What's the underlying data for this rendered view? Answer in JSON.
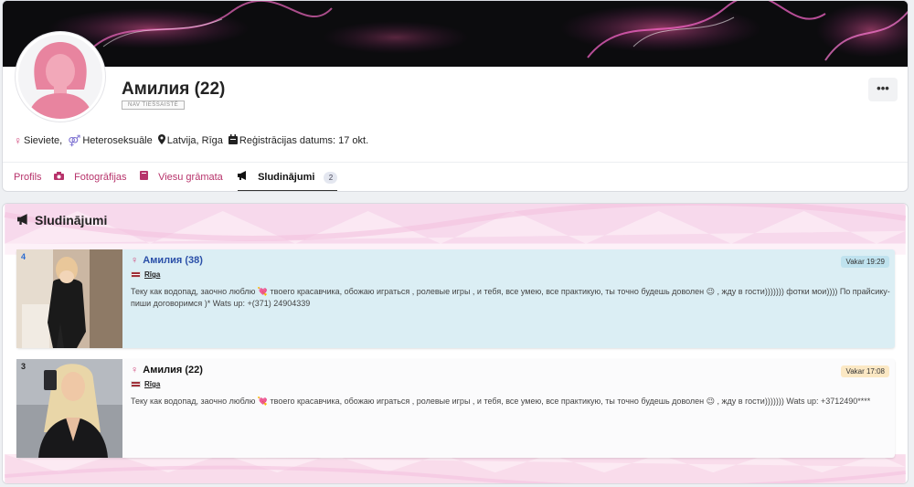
{
  "profile": {
    "name": "Амилия (22)",
    "status_badge": "NAV TIEŠSAISTĒ",
    "more_label": "•••",
    "meta": {
      "gender": "Sieviete,",
      "orientation": "Heteroseksuāle",
      "location": "Latvija, Rīga",
      "registration": "Reģistrācijas datums: 17 okt."
    }
  },
  "tabs": [
    {
      "label": "Profils",
      "icon": "none"
    },
    {
      "label": "Fotogrāfijas",
      "icon": "camera-icon"
    },
    {
      "label": "Viesu grāmata",
      "icon": "book-icon"
    },
    {
      "label": "Sludinājumi",
      "icon": "megaphone-icon",
      "count": "2",
      "active": true
    }
  ],
  "ads_section": {
    "title": "Sludinājumi",
    "ads": [
      {
        "rank": "4",
        "name": "Амилия (38)",
        "city": "Rīga",
        "time": "Vakar 19:29",
        "text": "Теку как водопад, заочно люблю 💘 твоего красавчика, обожаю играться , ролевые игры , и тебя, все умею, все практикую, ты точно будешь доволен 😉 , жду в гости))))))) фотки мои)))) По прайсику- пиши договоримся )* Wats up: +(371) 24904339"
      },
      {
        "rank": "3",
        "name": "Амилия (22)",
        "city": "Rīga",
        "time": "Vakar 17:08",
        "text": "Теку как водопад, заочно люблю 💘 твоего красавчика, обожаю играться , ролевые игры , и тебя, все умею, все практикую, ты точно будешь доволен 😉 , жду в гости))))))) Wats up: +3712490****"
      }
    ]
  },
  "colors": {
    "accent_pink": "#b7336b",
    "ad_highlight_bg": "#dbeef4",
    "latvia_flag": "#9e3039"
  }
}
